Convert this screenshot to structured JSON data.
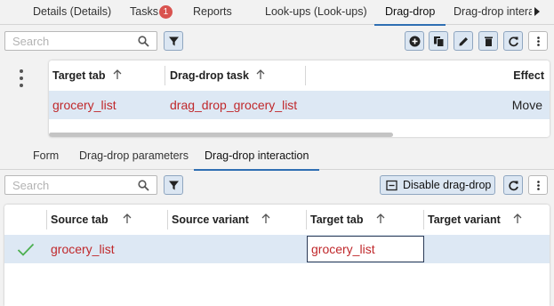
{
  "top_tabs": [
    "Details (Details)",
    "Tasks",
    "Reports",
    "Look-ups (Look-ups)",
    "Drag-drop",
    "Drag-drop interac"
  ],
  "tasks_badge": "1",
  "search": {
    "placeholder": "Search"
  },
  "grid1": {
    "headers": [
      "Target tab",
      "Drag-drop task",
      "Effect"
    ],
    "row": {
      "target_tab": "grocery_list",
      "task": "drag_drop_grocery_list",
      "effect": "Move"
    }
  },
  "mid_tabs": [
    "Form",
    "Drag-drop parameters",
    "Drag-drop interaction"
  ],
  "toolbar2": {
    "disable_label": "Disable drag-drop"
  },
  "grid2": {
    "headers": [
      "Source tab",
      "Source variant",
      "Target tab",
      "Target variant"
    ],
    "row": {
      "source_tab": "grocery_list",
      "source_variant": "",
      "target_tab": "grocery_list",
      "target_variant": ""
    }
  },
  "colors": {
    "accent": "#2f6fb3",
    "row_selected": "#dde8f4",
    "value_red": "#c0282b",
    "check_green": "#4caf50",
    "badge_red": "#d9534f"
  },
  "icons": [
    "chevron-right-icon",
    "search-icon",
    "filter-icon",
    "add-icon",
    "copy-icon",
    "edit-icon",
    "delete-icon",
    "refresh-icon",
    "more-vertical-icon",
    "sort-up-icon",
    "checkmark-icon",
    "disable-icon"
  ]
}
